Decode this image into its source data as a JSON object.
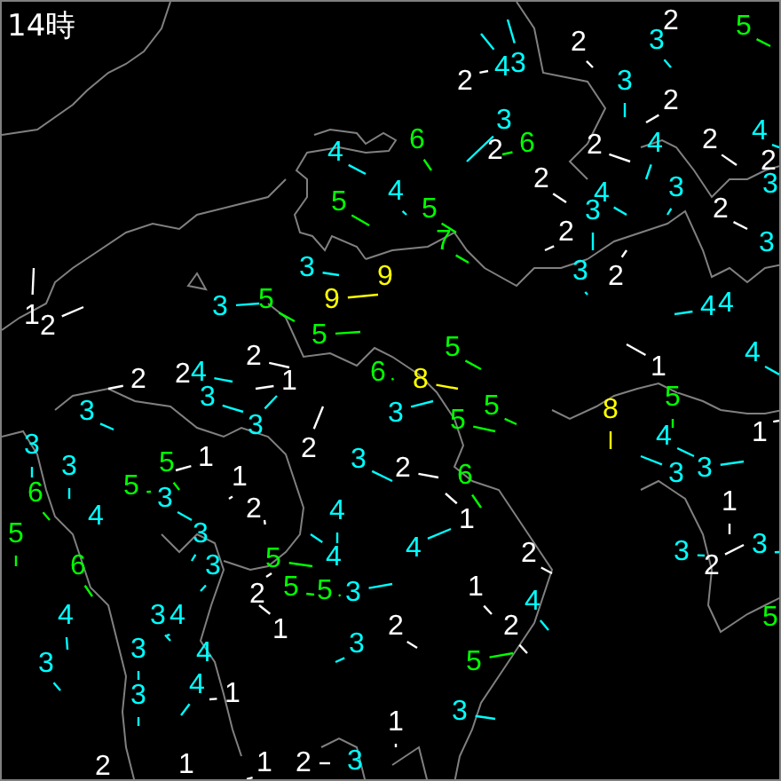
{
  "title": "14時",
  "stations": [
    {
      "speed": "4",
      "color": "#00ffff"
    },
    {
      "speed": "5",
      "color": "#00ff00"
    },
    {
      "speed": "4",
      "color": "#00ffff"
    },
    {
      "speed": "5",
      "color": "#00ff00"
    },
    {
      "speed": "7",
      "color": "#00ff00"
    },
    {
      "speed": "6",
      "color": "#00ff00"
    },
    {
      "speed": "2",
      "color": "#ffffff"
    },
    {
      "speed": "4",
      "color": "#00ffff"
    },
    {
      "speed": "3",
      "color": "#00ffff"
    },
    {
      "speed": "2",
      "color": "#ffffff"
    },
    {
      "speed": "2",
      "color": "#ffffff"
    },
    {
      "speed": "3",
      "color": "#00ffff"
    },
    {
      "speed": "5",
      "color": "#00ff00"
    },
    {
      "speed": "3",
      "color": "#00ffff"
    },
    {
      "speed": "2",
      "color": "#ffffff"
    },
    {
      "speed": "3",
      "color": "#00ffff"
    },
    {
      "speed": "2",
      "color": "#ffffff"
    },
    {
      "speed": "6",
      "color": "#00ff00"
    },
    {
      "speed": "2",
      "color": "#ffffff"
    },
    {
      "speed": "2",
      "color": "#ffffff"
    },
    {
      "speed": "4",
      "color": "#00ffff"
    },
    {
      "speed": "4",
      "color": "#00ffff"
    },
    {
      "speed": "3",
      "color": "#00ffff"
    },
    {
      "speed": "3",
      "color": "#00ffff"
    },
    {
      "speed": "2",
      "color": "#ffffff"
    },
    {
      "speed": "2",
      "color": "#ffffff"
    },
    {
      "speed": "4",
      "color": "#00ffff"
    },
    {
      "speed": "2",
      "color": "#ffffff"
    },
    {
      "speed": "3",
      "color": "#00ffff"
    },
    {
      "speed": "2",
      "color": "#ffffff"
    },
    {
      "speed": "3",
      "color": "#00ffff"
    },
    {
      "speed": "1",
      "color": "#ffffff"
    },
    {
      "speed": "2",
      "color": "#ffffff"
    },
    {
      "speed": "3",
      "color": "#00ffff"
    },
    {
      "speed": "5",
      "color": "#00ff00"
    },
    {
      "speed": "9",
      "color": "#ffff00"
    },
    {
      "speed": "9",
      "color": "#ffff00"
    },
    {
      "speed": "3",
      "color": "#00ffff"
    },
    {
      "speed": "5",
      "color": "#00ff00"
    },
    {
      "speed": "6",
      "color": "#00ff00"
    },
    {
      "speed": "2",
      "color": "#ffffff"
    },
    {
      "speed": "2",
      "color": "#ffffff"
    },
    {
      "speed": "2",
      "color": "#ffffff"
    },
    {
      "speed": "4",
      "color": "#00ffff"
    },
    {
      "speed": "1",
      "color": "#ffffff"
    },
    {
      "speed": "3",
      "color": "#00ffff"
    },
    {
      "speed": "3",
      "color": "#00ffff"
    },
    {
      "speed": "3",
      "color": "#00ffff"
    },
    {
      "speed": "2",
      "color": "#ffffff"
    },
    {
      "speed": "3",
      "color": "#00ffff"
    },
    {
      "speed": "3",
      "color": "#00ffff"
    },
    {
      "speed": "3",
      "color": "#00ffff"
    },
    {
      "speed": "6",
      "color": "#00ff00"
    },
    {
      "speed": "4",
      "color": "#00ffff"
    },
    {
      "speed": "5",
      "color": "#00ff00"
    },
    {
      "speed": "1",
      "color": "#ffffff"
    },
    {
      "speed": "5",
      "color": "#00ff00"
    },
    {
      "speed": "3",
      "color": "#00ffff"
    },
    {
      "speed": "1",
      "color": "#ffffff"
    },
    {
      "speed": "2",
      "color": "#ffffff"
    },
    {
      "speed": "4",
      "color": "#00ffff"
    },
    {
      "speed": "5",
      "color": "#00ff00"
    },
    {
      "speed": "8",
      "color": "#ffff00"
    },
    {
      "speed": "3",
      "color": "#00ffff"
    },
    {
      "speed": "5",
      "color": "#00ff00"
    },
    {
      "speed": "5",
      "color": "#00ff00"
    },
    {
      "speed": "2",
      "color": "#ffffff"
    },
    {
      "speed": "6",
      "color": "#00ff00"
    },
    {
      "speed": "1",
      "color": "#ffffff"
    },
    {
      "speed": "8",
      "color": "#ffff00"
    },
    {
      "speed": "5",
      "color": "#00ff00"
    },
    {
      "speed": "4",
      "color": "#00ffff"
    },
    {
      "speed": "3",
      "color": "#00ffff"
    },
    {
      "speed": "3",
      "color": "#00ffff"
    },
    {
      "speed": "1",
      "color": "#ffffff"
    },
    {
      "speed": "4",
      "color": "#00ffff"
    },
    {
      "speed": "1",
      "color": "#ffffff"
    },
    {
      "speed": "4",
      "color": "#00ffff"
    },
    {
      "speed": "4",
      "color": "#00ffff"
    },
    {
      "speed": "3",
      "color": "#00ffff"
    },
    {
      "speed": "2",
      "color": "#ffffff"
    },
    {
      "speed": "1",
      "color": "#ffffff"
    },
    {
      "speed": "5",
      "color": "#00ff00"
    },
    {
      "speed": "6",
      "color": "#00ff00"
    },
    {
      "speed": "4",
      "color": "#00ffff"
    },
    {
      "speed": "3",
      "color": "#00ffff"
    },
    {
      "speed": "3",
      "color": "#00ffff"
    },
    {
      "speed": "3",
      "color": "#00ffff"
    },
    {
      "speed": "3",
      "color": "#00ffff"
    },
    {
      "speed": "4",
      "color": "#00ffff"
    },
    {
      "speed": "3",
      "color": "#00ffff"
    },
    {
      "speed": "3",
      "color": "#00ffff"
    },
    {
      "speed": "4",
      "color": "#00ffff"
    },
    {
      "speed": "4",
      "color": "#00ffff"
    },
    {
      "speed": "1",
      "color": "#ffffff"
    },
    {
      "speed": "5",
      "color": "#00ff00"
    },
    {
      "speed": "2",
      "color": "#ffffff"
    },
    {
      "speed": "5",
      "color": "#00ff00"
    },
    {
      "speed": "5",
      "color": "#00ff00"
    },
    {
      "speed": "3",
      "color": "#00ffff"
    },
    {
      "speed": "4",
      "color": "#00ffff"
    },
    {
      "speed": "1",
      "color": "#ffffff"
    },
    {
      "speed": "3",
      "color": "#00ffff"
    },
    {
      "speed": "2",
      "color": "#ffffff"
    },
    {
      "speed": "1",
      "color": "#ffffff"
    },
    {
      "speed": "1",
      "color": "#ffffff"
    },
    {
      "speed": "2",
      "color": "#ffffff"
    },
    {
      "speed": "3",
      "color": "#00ffff"
    },
    {
      "speed": "4",
      "color": "#00ffff"
    },
    {
      "speed": "2",
      "color": "#ffffff"
    },
    {
      "speed": "1",
      "color": "#ffffff"
    },
    {
      "speed": "4",
      "color": "#00ffff"
    },
    {
      "speed": "2",
      "color": "#ffffff"
    },
    {
      "speed": "5",
      "color": "#00ff00"
    },
    {
      "speed": "3",
      "color": "#00ffff"
    },
    {
      "speed": "1",
      "color": "#ffffff"
    },
    {
      "speed": "3",
      "color": "#00ffff"
    },
    {
      "speed": "2",
      "color": "#ffffff"
    },
    {
      "speed": "3",
      "color": "#00ffff"
    },
    {
      "speed": "2",
      "color": "#ffffff"
    },
    {
      "speed": "5",
      "color": "#00ff00"
    }
  ]
}
